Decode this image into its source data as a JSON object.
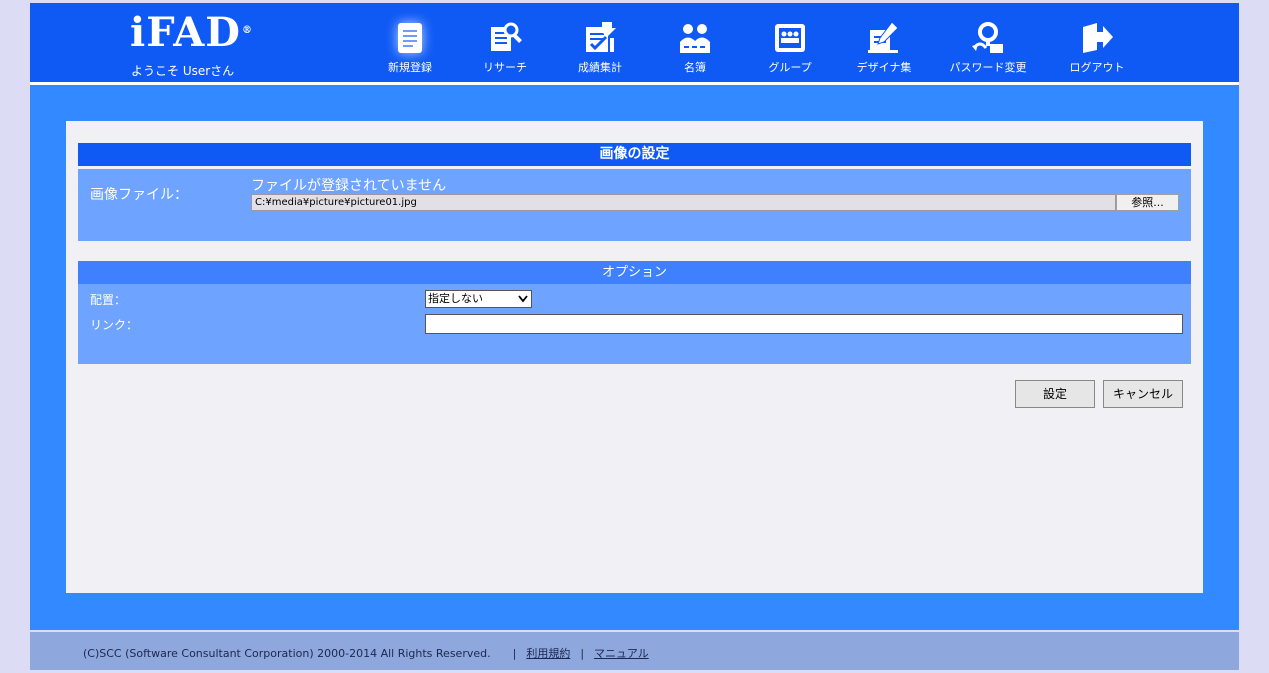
{
  "header": {
    "logo_text": "iFAD",
    "logo_mark": "®",
    "welcome": "ようこそ Userさん",
    "nav": [
      {
        "label": "新規登録",
        "icon": "new-document-icon",
        "active": true
      },
      {
        "label": "リサーチ",
        "icon": "research-icon",
        "active": false
      },
      {
        "label": "成績集計",
        "icon": "results-icon",
        "active": false
      },
      {
        "label": "名簿",
        "icon": "roster-icon",
        "active": false
      },
      {
        "label": "グループ",
        "icon": "group-icon",
        "active": false
      },
      {
        "label": "デザイナ集",
        "icon": "designer-icon",
        "active": false
      },
      {
        "label": "パスワード変更",
        "icon": "password-icon",
        "active": false
      },
      {
        "label": "ログアウト",
        "icon": "logout-icon",
        "active": false
      }
    ]
  },
  "image_section": {
    "title": "画像の設定",
    "file_label": "画像ファイル：",
    "file_status": "ファイルが登録されていません",
    "file_path": "C:¥media¥picture¥picture01.jpg",
    "browse_label": "参照..."
  },
  "options_section": {
    "title": "オプション",
    "align_label": "配置：",
    "align_value": "指定しない",
    "link_label": "リンク：",
    "link_value": ""
  },
  "buttons": {
    "ok": "設定",
    "cancel": "キャンセル"
  },
  "footer": {
    "copyright": "(C)SCC (Software Consultant Corporation) 2000-2014 All Rights Reserved.",
    "separator": "|",
    "terms": "利用規約",
    "manual": "マニュアル"
  },
  "colors": {
    "header_blue": "#0f59f5",
    "band_blue": "#3389ff",
    "section_blue": "#6ea3ff",
    "footer": "#8ea7dd"
  }
}
